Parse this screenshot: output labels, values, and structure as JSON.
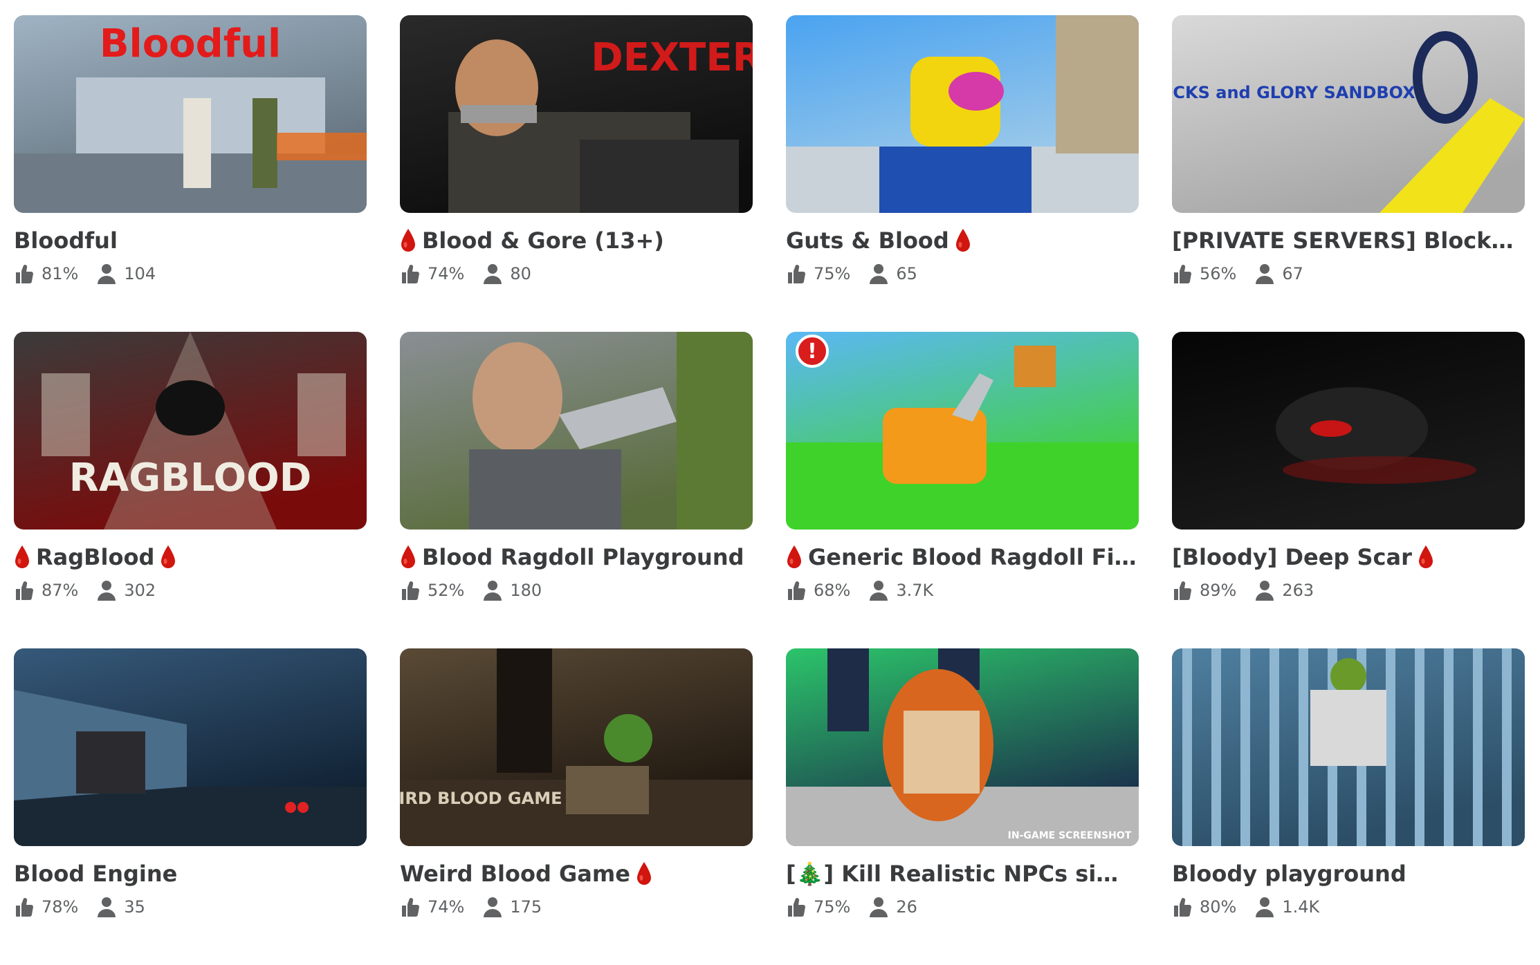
{
  "games": [
    {
      "title": "Bloodful",
      "drop_before": false,
      "drop_after": false,
      "rating": "81%",
      "players": "104",
      "thumb": {
        "bg1": "#9fb3c4",
        "bg2": "#5f6d78",
        "accent": "#d01818",
        "text": "Bloodful",
        "text_color": "#e31b1b",
        "icon": "zombie-scene"
      }
    },
    {
      "title": "Blood & Gore (13+)",
      "drop_before": true,
      "drop_after": false,
      "rating": "74%",
      "players": "80",
      "thumb": {
        "bg1": "#2a2a2a",
        "bg2": "#0d0d0d",
        "accent": "#c21010",
        "text": "DEXTER",
        "text_color": "#d11a1a",
        "icon": "bound-figure"
      }
    },
    {
      "title": "Guts & Blood",
      "drop_before": false,
      "drop_after": true,
      "rating": "75%",
      "players": "65",
      "thumb": {
        "bg1": "#4aa3f0",
        "bg2": "#a9cfe8",
        "accent": "#f2d50f",
        "text": "",
        "text_color": "#ffffff",
        "icon": "noob-head"
      }
    },
    {
      "title": "[PRIVATE SERVERS] Blocks and...",
      "drop_before": false,
      "drop_after": false,
      "rating": "56%",
      "players": "67",
      "thumb": {
        "bg1": "#d9d9d9",
        "bg2": "#a8a8a8",
        "accent": "#f1e21a",
        "text": "BLOCKS and GLORY SANDBOX",
        "text_color": "#1e3fb0",
        "icon": "sword"
      }
    },
    {
      "title": "RagBlood",
      "drop_before": true,
      "drop_after": true,
      "rating": "87%",
      "players": "302",
      "thumb": {
        "bg1": "#3b3b3b",
        "bg2": "#7a0b0b",
        "accent": "#e8e1d0",
        "text": "RAGBLOOD",
        "text_color": "#f0ece2",
        "icon": "falling-figure"
      }
    },
    {
      "title": "Blood Ragdoll Playground",
      "drop_before": true,
      "drop_after": false,
      "rating": "52%",
      "players": "180",
      "thumb": {
        "bg1": "#8a8f94",
        "bg2": "#5a6d3c",
        "accent": "#c49a7a",
        "text": "",
        "text_color": "#ffffff",
        "icon": "face-closeup"
      }
    },
    {
      "title": "Generic Blood Ragdoll Fight...",
      "drop_before": true,
      "drop_after": false,
      "rating": "68%",
      "players": "3.7K",
      "thumb": {
        "bg1": "#5bb8f5",
        "bg2": "#3fd22a",
        "accent": "#f39a1a",
        "text": "!",
        "text_color": "#ffffff",
        "icon": "chainsaw"
      }
    },
    {
      "title": "[Bloody] Deep Scar",
      "drop_before": false,
      "drop_after": true,
      "rating": "89%",
      "players": "263",
      "thumb": {
        "bg1": "#050505",
        "bg2": "#1a1a1a",
        "accent": "#c71414",
        "text": "",
        "text_color": "#ffffff",
        "icon": "dark-creature"
      }
    },
    {
      "title": "Blood Engine",
      "drop_before": false,
      "drop_after": false,
      "rating": "78%",
      "players": "35",
      "thumb": {
        "bg1": "#36597a",
        "bg2": "#0f1f30",
        "accent": "#e02222",
        "text": "",
        "text_color": "#ffffff",
        "icon": "rain-soldiers"
      }
    },
    {
      "title": "Weird Blood Game",
      "drop_before": false,
      "drop_after": true,
      "rating": "74%",
      "players": "175",
      "thumb": {
        "bg1": "#5a4a36",
        "bg2": "#1c150e",
        "accent": "#4a8a2c",
        "text": "WEIRD BLOOD GAME",
        "text_color": "#d9cfb8",
        "icon": "room"
      }
    },
    {
      "title": "[🎄] Kill Realistic NPCs simulat...",
      "drop_before": false,
      "drop_after": false,
      "rating": "75%",
      "players": "26",
      "thumb": {
        "bg1": "#2cc46a",
        "bg2": "#1a2c4a",
        "accent": "#d9661e",
        "text": "IN-GAME SCREENSHOT",
        "text_color": "#ffffff",
        "icon": "npc-face"
      }
    },
    {
      "title": "Bloody playground",
      "drop_before": false,
      "drop_after": false,
      "rating": "80%",
      "players": "1.4K",
      "thumb": {
        "bg1": "#4f7fa0",
        "bg2": "#2c4e66",
        "accent": "#6a9a2a",
        "text": "",
        "text_color": "#ffffff",
        "icon": "cage"
      }
    }
  ],
  "icons": {
    "rating": "thumbs-up-icon",
    "players": "person-icon",
    "blood": "blood-drop-icon"
  },
  "colors": {
    "title": "#393b3d",
    "stat": "#606264",
    "drop": "#d1150f"
  }
}
